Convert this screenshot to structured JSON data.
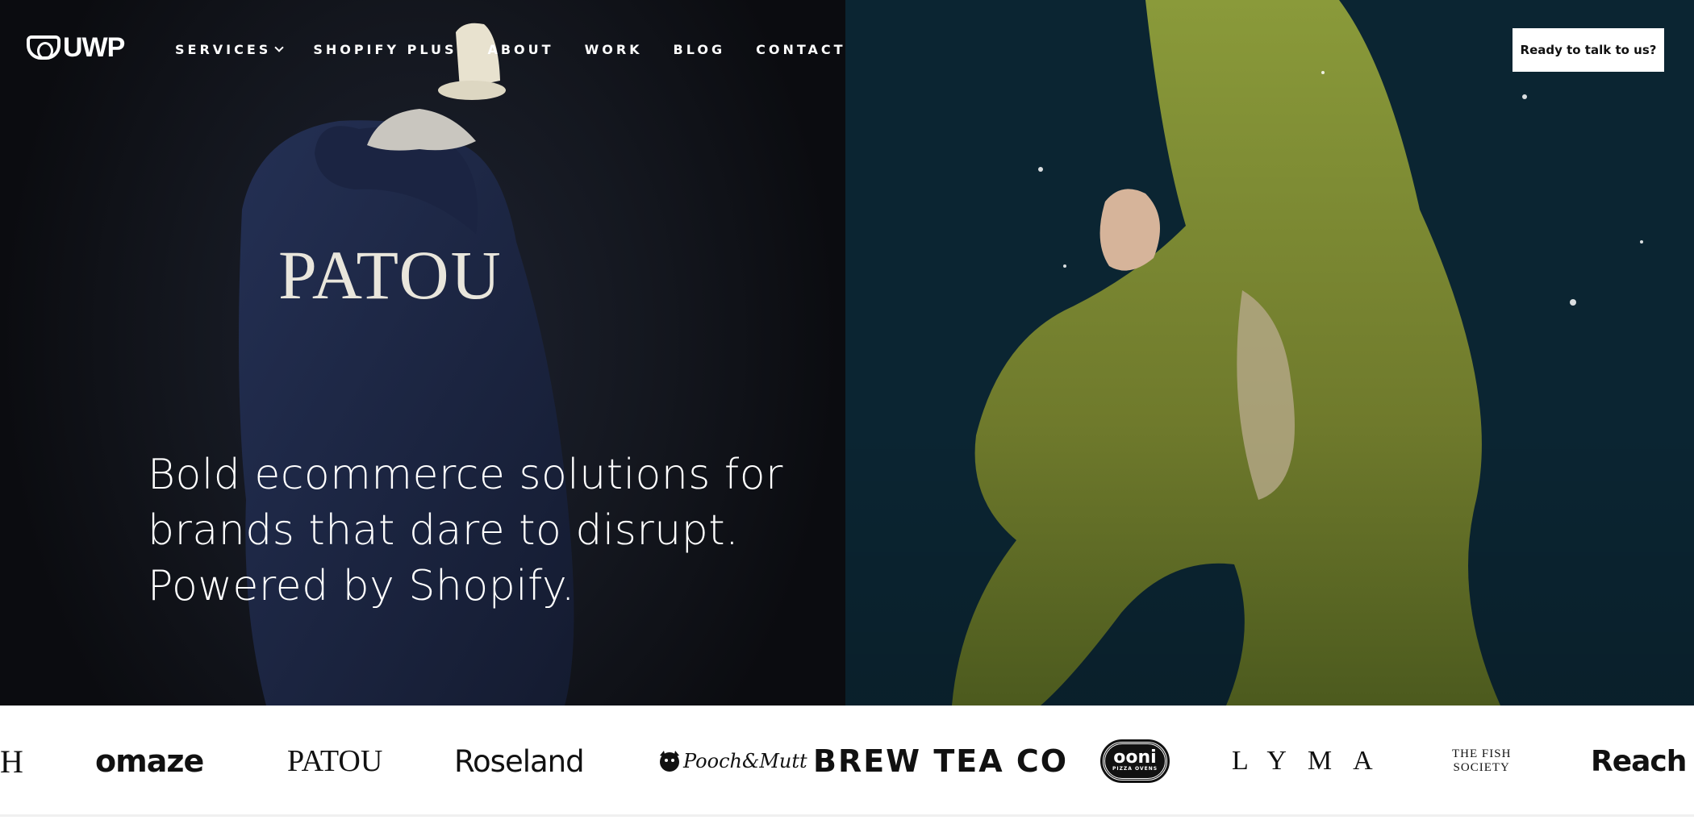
{
  "header": {
    "logo_text": "UWP",
    "nav": [
      {
        "label": "SERVICES",
        "has_dropdown": true
      },
      {
        "label": "SHOPIFY PLUS"
      },
      {
        "label": "ABOUT"
      },
      {
        "label": "WORK"
      },
      {
        "label": "BLOG"
      },
      {
        "label": "CONTACT"
      }
    ],
    "cta_label": "Ready to talk to us?"
  },
  "hero": {
    "headline_lines": [
      "Bold ecommerce solutions for",
      "brands that dare to disrupt.",
      "Powered by Shopify."
    ],
    "left_image_text": "PATOU"
  },
  "brand_strip": {
    "logos": [
      {
        "name": "partial-brand",
        "text": "H"
      },
      {
        "name": "omaze",
        "text": "omaze"
      },
      {
        "name": "patou",
        "text": "PATOU"
      },
      {
        "name": "roseland",
        "text": "Roseland"
      },
      {
        "name": "pooch-and-mutt",
        "text": "Pooch&Mutt"
      },
      {
        "name": "brew-tea-co",
        "text": "BREW TEA CO"
      },
      {
        "name": "ooni",
        "text": "ooni",
        "subtext": "PIZZA OVENS"
      },
      {
        "name": "lyma",
        "text": "LYMA"
      },
      {
        "name": "the-fish-society",
        "text_lines": [
          "THE FISH",
          "SOCIETY"
        ]
      },
      {
        "name": "reach",
        "text": "Reach"
      }
    ]
  },
  "colors": {
    "nav_text": "#ffffff",
    "cta_bg": "#ffffff",
    "cta_text": "#111111",
    "strip_bg": "#ffffff",
    "water": "#103546",
    "dark_bg": "#14171f",
    "coat": "#1a2238",
    "dress": "#6f7a2c"
  }
}
